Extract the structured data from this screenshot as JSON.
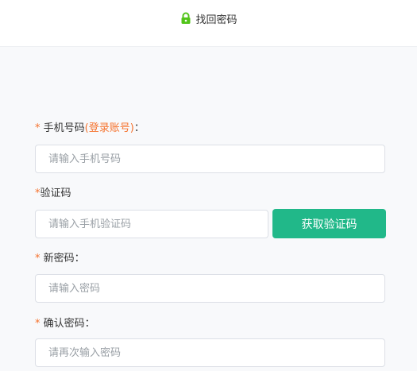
{
  "header": {
    "title": "找回密码"
  },
  "form": {
    "phone": {
      "required_mark": "*",
      "label": "手机号码",
      "hint": "(登录账号)",
      "colon": "：",
      "placeholder": "请输入手机号码",
      "value": ""
    },
    "code": {
      "required_mark": "*",
      "label": "验证码",
      "placeholder": "请输入手机验证码",
      "value": "",
      "button_label": "获取验证码"
    },
    "new_password": {
      "required_mark": "*",
      "label": "新密码",
      "colon": "：",
      "placeholder": "请输入密码",
      "value": ""
    },
    "confirm_password": {
      "required_mark": "*",
      "label": "确认密码",
      "colon": "：",
      "placeholder": "请再次输入密码",
      "value": ""
    }
  },
  "colors": {
    "accent": "#21b889",
    "required": "#f5722d",
    "lock_icon": "#52c41a"
  },
  "icons": {
    "header_icon": "lock-icon"
  }
}
